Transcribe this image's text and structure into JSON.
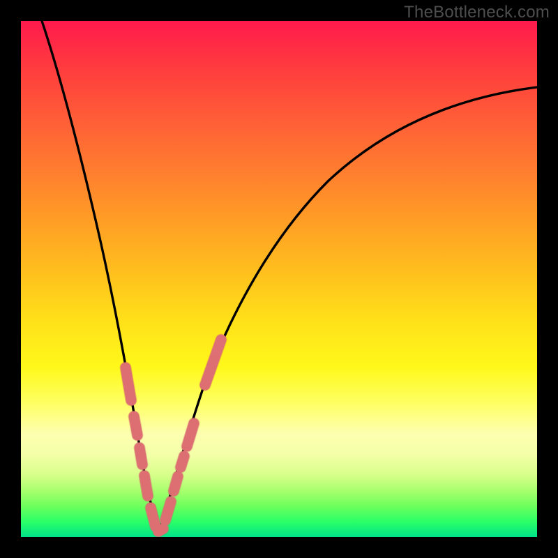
{
  "watermark": "TheBottleneck.com",
  "colors": {
    "frame": "#000000",
    "curve": "#000000",
    "segment_marker": "#e77a7e",
    "segment_stroke": "#c94f57"
  },
  "chart_data": {
    "type": "line",
    "title": "",
    "xlabel": "",
    "ylabel": "",
    "xlim": [
      0,
      100
    ],
    "ylim": [
      0,
      100
    ],
    "grid": false,
    "legend": false,
    "note": "Bottleneck curve. x is normalized component scale, y is bottleneck percentage. Minimum near x≈26 (y≈0). Values estimated from pixel positions.",
    "series": [
      {
        "name": "bottleneck",
        "x": [
          4,
          8,
          12,
          15,
          18,
          20,
          22,
          24,
          26,
          28,
          30,
          33,
          37,
          43,
          50,
          58,
          67,
          77,
          88,
          100
        ],
        "y": [
          100,
          85,
          67,
          53,
          40,
          30,
          20,
          10,
          1,
          6,
          15,
          26,
          38,
          50,
          60,
          68,
          75,
          80,
          84,
          87
        ]
      }
    ],
    "marker_segments": {
      "note": "pink rounded segments highlighting portions of the curve near the minimum",
      "left_branch_y_ranges": [
        [
          40,
          30
        ],
        [
          26,
          22
        ],
        [
          19,
          15
        ],
        [
          13,
          9
        ],
        [
          7,
          3
        ]
      ],
      "right_branch_y_ranges": [
        [
          2,
          5
        ],
        [
          6,
          11
        ],
        [
          12,
          14
        ],
        [
          15,
          20
        ],
        [
          28,
          40
        ]
      ]
    }
  }
}
